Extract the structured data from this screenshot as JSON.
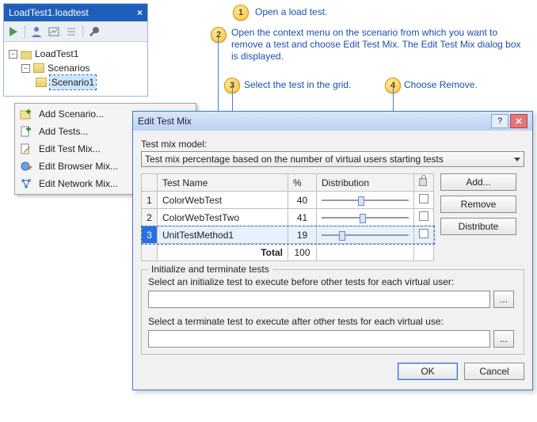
{
  "toolwindow": {
    "tab_label": "LoadTest1.loadtest",
    "tree": {
      "root": "LoadTest1",
      "scenarios_label": "Scenarios",
      "scenario1": "Scenario1"
    }
  },
  "context_menu": {
    "items": [
      "Add Scenario...",
      "Add Tests...",
      "Edit Test Mix...",
      "Edit Browser Mix...",
      "Edit Network Mix..."
    ]
  },
  "steps": {
    "s1": "Open a load test.",
    "s2": "Open the context menu on the scenario from which you want to remove a test and choose Edit Test Mix. The Edit Test Mix dialog box is displayed.",
    "s3": "Select the test in the grid.",
    "s4": "Choose Remove."
  },
  "dialog": {
    "title": "Edit Test Mix",
    "model_label": "Test mix model:",
    "model_value": "Test mix percentage based on the number of virtual users starting tests",
    "columns": {
      "name": "Test Name",
      "pct": "%",
      "dist": "Distribution"
    },
    "rows": [
      {
        "num": "1",
        "name": "ColorWebTest",
        "pct": "40",
        "thumb": 46
      },
      {
        "num": "2",
        "name": "ColorWebTestTwo",
        "pct": "41",
        "thumb": 48
      },
      {
        "num": "3",
        "name": "UnitTestMethod1",
        "pct": "19",
        "thumb": 22
      }
    ],
    "total_label": "Total",
    "total_value": "100",
    "buttons": {
      "add": "Add...",
      "remove": "Remove",
      "distribute": "Distribute"
    },
    "group_title": "Initialize and terminate tests",
    "init_label": "Select an initialize test to execute before other tests for each virtual user:",
    "term_label": "Select a terminate test to execute after other tests for each virtual use:",
    "ellipsis": "...",
    "ok": "OK",
    "cancel": "Cancel",
    "help_icon": "?",
    "close_icon": "✕"
  }
}
